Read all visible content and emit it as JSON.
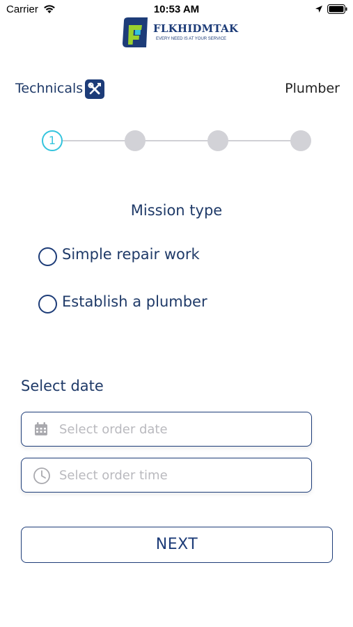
{
  "status_bar": {
    "carrier": "Carrier",
    "time": "10:53 AM"
  },
  "logo": {
    "name": "FLKHIDMTAK",
    "tagline": "EVERY NEED IS AT YOUR SERVICE"
  },
  "header": {
    "category": "Technicals",
    "service": "Plumber",
    "category_icon": "tools-icon"
  },
  "stepper": {
    "steps": [
      "1",
      "",
      "",
      ""
    ],
    "active_step": 1,
    "accent_color": "#34c4dd"
  },
  "mission": {
    "title": "Mission type",
    "options": [
      {
        "label": "Simple repair work"
      },
      {
        "label": "Establish a plumber"
      }
    ]
  },
  "date_section": {
    "title": "Select date",
    "date_placeholder": "Select order date",
    "time_placeholder": "Select order time"
  },
  "actions": {
    "next_label": "NEXT"
  },
  "colors": {
    "primary": "#1d3c78",
    "accent": "#34c4dd",
    "inactive_step": "#d2d2d7"
  }
}
